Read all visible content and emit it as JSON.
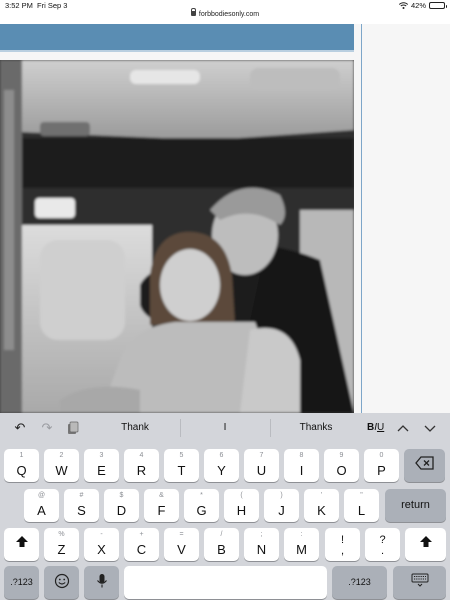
{
  "status_bar": {
    "time": "3:52 PM",
    "date": "Fri Sep 3",
    "url": "forbbodiesonly.com",
    "battery_percent": "42%",
    "battery_level": 0.42,
    "icons": [
      "lock-icon",
      "wifi-icon",
      "battery-icon"
    ]
  },
  "page": {
    "accent_color": "#5a8db3",
    "image": "photo"
  },
  "keyboard": {
    "toolbar": {
      "icons": [
        "undo-icon",
        "redo-icon",
        "paste-icon",
        "chevron-up-icon",
        "chevron-down-icon"
      ],
      "suggestions": [
        "Thank",
        "I",
        "Thanks"
      ],
      "format_bold": "B",
      "format_italic": "I",
      "format_underline": "U"
    },
    "row1": [
      {
        "alt": "1",
        "main": "Q"
      },
      {
        "alt": "2",
        "main": "W"
      },
      {
        "alt": "3",
        "main": "E"
      },
      {
        "alt": "4",
        "main": "R"
      },
      {
        "alt": "5",
        "main": "T"
      },
      {
        "alt": "6",
        "main": "Y"
      },
      {
        "alt": "7",
        "main": "U"
      },
      {
        "alt": "8",
        "main": "I"
      },
      {
        "alt": "9",
        "main": "O"
      },
      {
        "alt": "0",
        "main": "P"
      }
    ],
    "row2": [
      {
        "alt": "@",
        "main": "A"
      },
      {
        "alt": "#",
        "main": "S"
      },
      {
        "alt": "$",
        "main": "D"
      },
      {
        "alt": "&",
        "main": "F"
      },
      {
        "alt": "*",
        "main": "G"
      },
      {
        "alt": "(",
        "main": "H"
      },
      {
        "alt": ")",
        "main": "J"
      },
      {
        "alt": "'",
        "main": "K"
      },
      {
        "alt": "\"",
        "main": "L"
      }
    ],
    "row3": [
      {
        "alt": "%",
        "main": "Z"
      },
      {
        "alt": "-",
        "main": "X"
      },
      {
        "alt": "+",
        "main": "C"
      },
      {
        "alt": "=",
        "main": "V"
      },
      {
        "alt": "/",
        "main": "B"
      },
      {
        "alt": ";",
        "main": "N"
      },
      {
        "alt": ":",
        "main": "M"
      }
    ],
    "punct": [
      {
        "top": "!",
        "bottom": ","
      },
      {
        "top": "?",
        "bottom": "."
      }
    ],
    "return_label": "return",
    "numbers_label": ".?123"
  }
}
